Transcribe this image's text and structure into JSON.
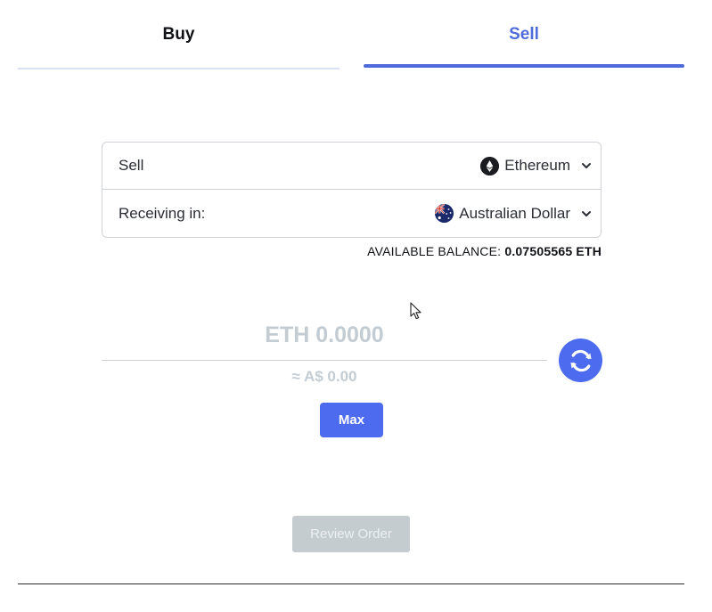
{
  "tabs": [
    {
      "label": "Buy",
      "active": false
    },
    {
      "label": "Sell",
      "active": true
    }
  ],
  "selector": {
    "sell_label": "Sell",
    "sell_asset": "Ethereum",
    "receive_label": "Receiving in:",
    "receive_currency": "Australian Dollar"
  },
  "balance": {
    "label": "AVAILABLE BALANCE:",
    "value": "0.07505565 ETH"
  },
  "amount": {
    "placeholder": "ETH 0.0000",
    "converted": "≈ A$ 0.00"
  },
  "buttons": {
    "max_label": "Max",
    "review_label": "Review Order"
  },
  "icons": {
    "asset_icon": "ethereum-icon",
    "currency_icon": "australia-flag-icon",
    "swap_icon": "refresh-icon",
    "dropdown_icon": "chevron-down-icon"
  },
  "colors": {
    "accent": "#4d6bef",
    "active_tab": "#4f6bdb",
    "disabled_button": "#c4ccd0",
    "placeholder_text": "#c4ccd3"
  }
}
